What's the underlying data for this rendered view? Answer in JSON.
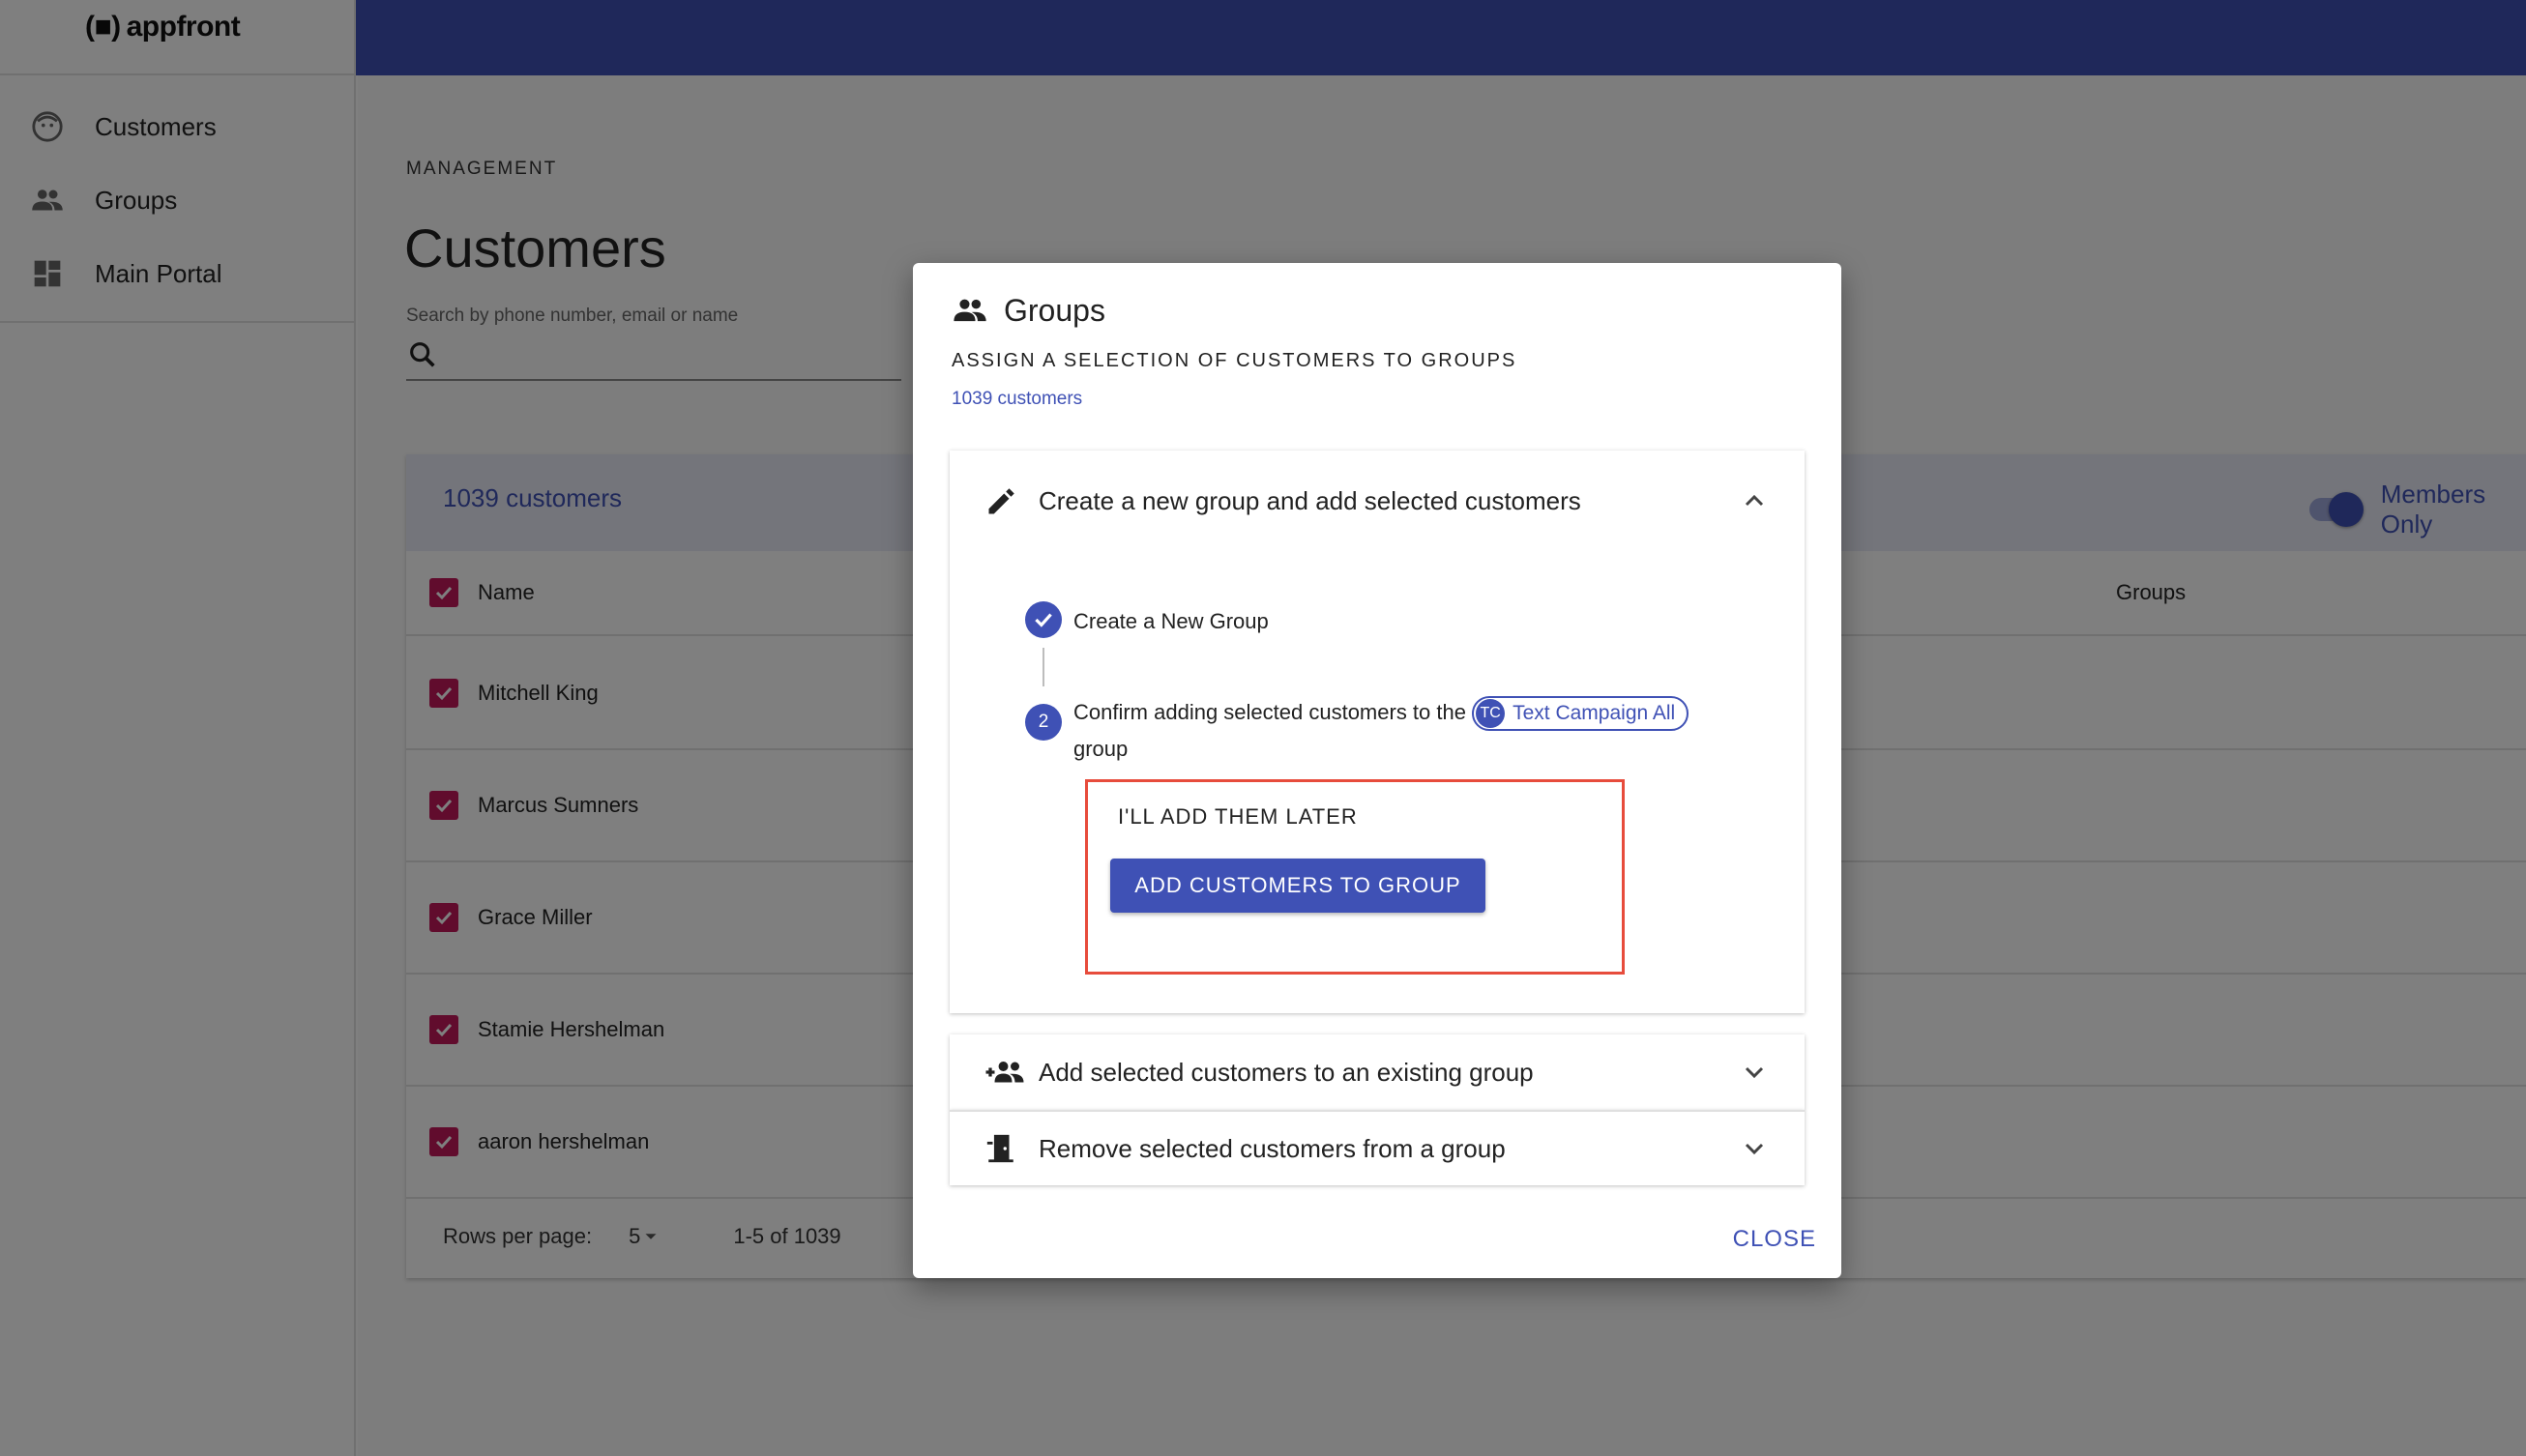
{
  "app": {
    "logo_text": "appfront",
    "logo_mark": "(■)"
  },
  "sidebar": {
    "items": [
      {
        "label": "Customers",
        "icon": "face-icon"
      },
      {
        "label": "Groups",
        "icon": "people-icon"
      },
      {
        "label": "Main Portal",
        "icon": "dashboard-icon"
      }
    ]
  },
  "page": {
    "overline": "MANAGEMENT",
    "title": "Customers",
    "search_label": "Search by phone number, email or name",
    "search_value": ""
  },
  "table": {
    "count_label": "1039 customers",
    "members_only_label": "Members Only",
    "members_only_on": true,
    "columns": [
      "Name",
      "Groups"
    ],
    "rows": [
      "Mitchell King",
      "Marcus Sumners",
      "Grace Miller",
      "Stamie Hershelman",
      "aaron hershelman"
    ],
    "rows_per_page_label": "Rows per page:",
    "rows_per_page_value": "5",
    "range_label": "1-5 of 1039"
  },
  "dialog": {
    "title": "Groups",
    "subtitle": "ASSIGN A SELECTION OF CUSTOMERS TO GROUPS",
    "count": "1039 customers",
    "panel_create": {
      "title": "Create a new group and add selected customers",
      "step1_label": "Create a New Group",
      "step2_number": "2",
      "step2_text_before": "Confirm adding selected customers to the",
      "step2_text_after": "group",
      "chip_avatar": "TC",
      "chip_label": "Text Campaign All",
      "later_button": "I'LL ADD THEM LATER",
      "add_button": "ADD CUSTOMERS TO GROUP"
    },
    "panel_existing": {
      "title": "Add selected customers to an existing group"
    },
    "panel_remove": {
      "title": "Remove selected customers from a group"
    },
    "close_label": "CLOSE"
  },
  "colors": {
    "primary": "#3f51b5",
    "checkbox": "#c2185b",
    "highlight": "#e74c3c"
  }
}
